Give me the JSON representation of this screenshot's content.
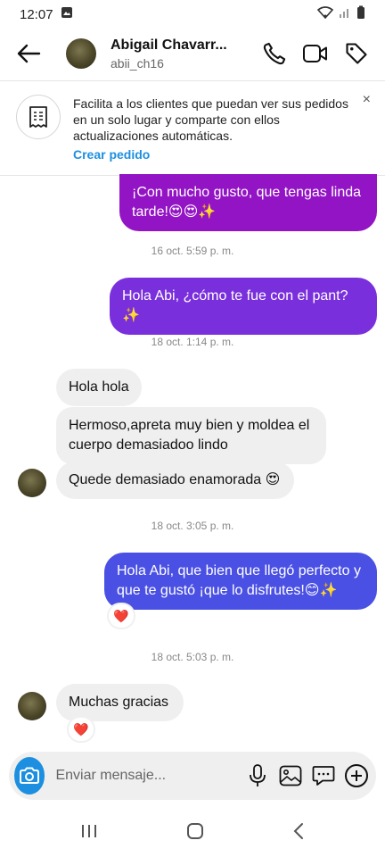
{
  "status_bar": {
    "time": "12:07"
  },
  "header": {
    "contact_name": "Abigail Chavarr...",
    "username": "abii_ch16"
  },
  "banner": {
    "text": "Facilita a los clientes que puedan ver sus pedidos en un solo lugar y comparte con ellos actualizaciones automáticas.",
    "link": "Crear pedido",
    "close": "×"
  },
  "messages": [
    {
      "direction": "out",
      "text": "¡Con mucho gusto, que tengas linda tarde!😍😍✨"
    },
    {
      "timestamp": "16 oct. 5:59 p. m."
    },
    {
      "direction": "out",
      "text": "Hola Abi, ¿cómo te fue con el pant?✨"
    },
    {
      "timestamp": "18 oct. 1:14 p. m."
    },
    {
      "direction": "in",
      "text": "Hola hola"
    },
    {
      "direction": "in",
      "text": "Hermoso,apreta muy bien y moldea el cuerpo demasiadoo lindo"
    },
    {
      "direction": "in",
      "text": "Quede demasiado enamorada 😍"
    },
    {
      "timestamp": "18 oct. 3:05 p. m."
    },
    {
      "direction": "out",
      "text": "Hola Abi, que bien que llegó perfecto y que te gustó ¡que lo disfrutes!😊✨",
      "reaction": "❤️"
    },
    {
      "timestamp": "18 oct. 5:03 p. m."
    },
    {
      "direction": "in",
      "text": "Muchas gracias",
      "reaction": "❤️"
    }
  ],
  "composer": {
    "placeholder": "Enviar mensaje..."
  },
  "colors": {
    "bubble_purple": "#9314c4",
    "bubble_violet": "#7a2fdc",
    "bubble_blue": "#4a50e3",
    "link_blue": "#1d8fe0",
    "incoming_bg": "#efefef"
  }
}
